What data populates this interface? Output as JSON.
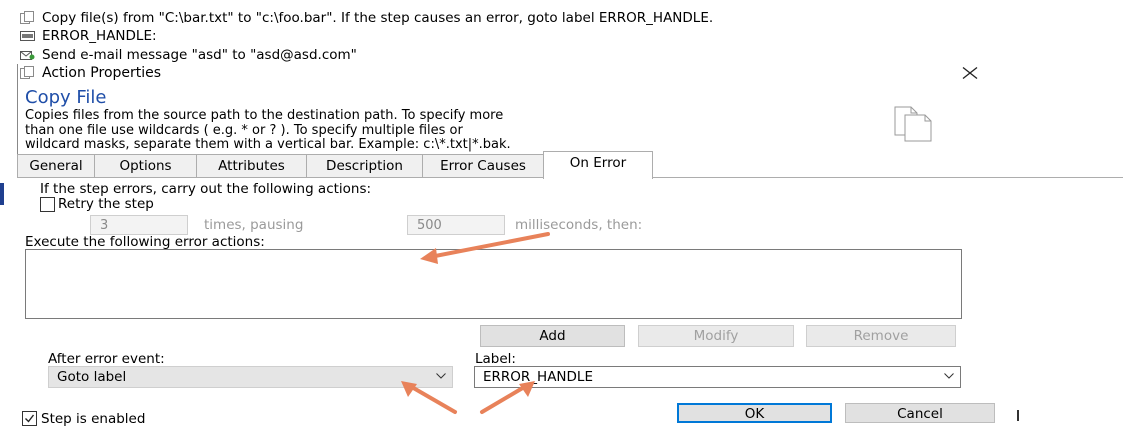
{
  "steps": [
    {
      "icon": "copy-file-icon",
      "text": "Copy file(s) from \"C:\\bar.txt\" to \"c:\\foo.bar\".  If the step causes an error, goto label ERROR_HANDLE."
    },
    {
      "icon": "label-icon",
      "text": "ERROR_HANDLE:"
    },
    {
      "icon": "email-icon",
      "text": "Send e-mail message \"asd\" to \"asd@asd.com\""
    }
  ],
  "dialog": {
    "title": "Action Properties",
    "close_icon": "close-icon",
    "heading": "Copy File",
    "description": [
      "Copies files from the source path to the destination path.  To specify more",
      "than one file use wildcards ( e.g. * or ? ).  To specify multiple files or",
      "wildcard masks, separate them with a vertical bar.  Example: c:\\*.txt|*.bak."
    ],
    "tabs": [
      "General",
      "Options",
      "Attributes",
      "Description",
      "Error Causes",
      "On Error"
    ],
    "active_tab": "On Error"
  },
  "on_error": {
    "intro": "If the step errors, carry out the following actions:",
    "retry_label": "Retry the step",
    "retry_checked": false,
    "retry_times": "3",
    "times_label": "times, pausing",
    "pause_ms": "500",
    "ms_label": "milliseconds, then:",
    "execute_label": "Execute the following error actions:",
    "add_label": "Add",
    "modify_label": "Modify",
    "remove_label": "Remove",
    "after_label": "After error event:",
    "after_value": "Goto label",
    "label_label": "Label:",
    "label_value": "ERROR_HANDLE"
  },
  "footer": {
    "enabled_label": "Step is enabled",
    "enabled_checked": true,
    "ok_label": "OK",
    "cancel_label": "Cancel"
  },
  "colors": {
    "heading": "#1f4ea8",
    "annotation_arrow": "#e8825a",
    "ok_border": "#0078d7"
  }
}
